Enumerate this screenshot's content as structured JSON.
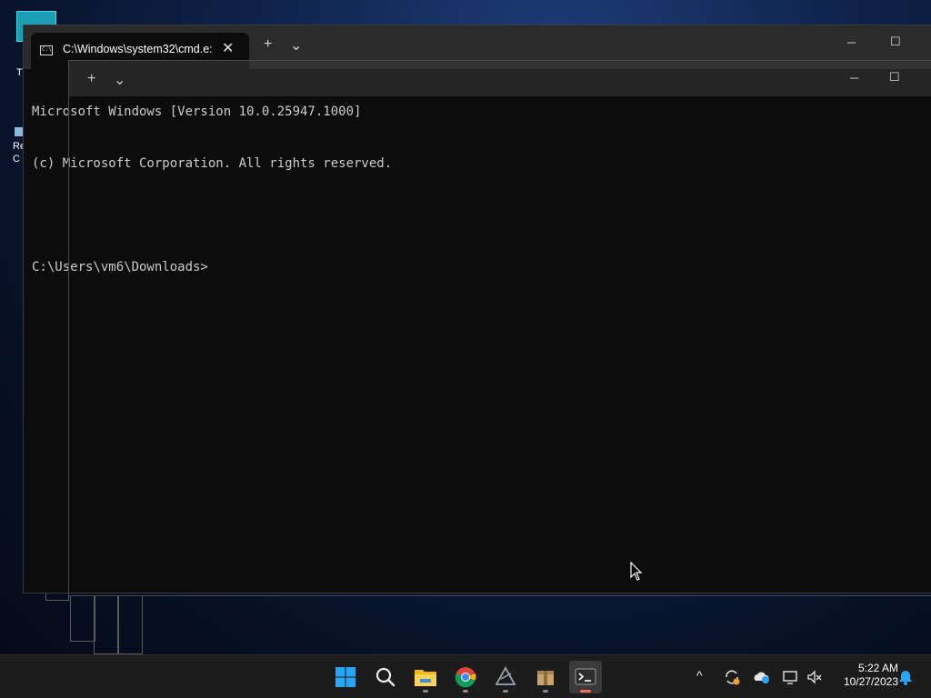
{
  "desktop": {
    "icons": [
      {
        "label": "T"
      },
      {
        "label": "Re C"
      }
    ]
  },
  "window": {
    "tab_title": "C:\\Windows\\system32\\cmd.e:",
    "tab_icon_text": "C:\\",
    "close_tab_glyph": "✕",
    "new_tab_glyph": "+",
    "dropdown_glyph": "⌄",
    "minimize_glyph": "─",
    "maximize_glyph": "☐",
    "console_lines": [
      "Microsoft Windows [Version 10.0.25947.1000]",
      "(c) Microsoft Corporation. All rights reserved.",
      "",
      "C:\\Users\\vm6\\Downloads>"
    ]
  },
  "ghost_window": {
    "new_tab_glyph": "+",
    "dropdown_glyph": "⌄",
    "minimize_glyph": "─",
    "maximize_glyph": "☐"
  },
  "taskbar": {
    "apps": [
      {
        "name": "start",
        "active": false
      },
      {
        "name": "search",
        "active": false
      },
      {
        "name": "file-explorer",
        "active": false
      },
      {
        "name": "chrome",
        "active": false
      },
      {
        "name": "app",
        "active": false
      },
      {
        "name": "package",
        "active": false
      },
      {
        "name": "terminal",
        "active": true
      }
    ],
    "tray": {
      "chevron_glyph": "^",
      "time": "5:22 AM",
      "date": "10/27/2023"
    }
  },
  "colors": {
    "accent_red": "#ff6b5e",
    "console_bg": "#0c0c0c",
    "console_text": "#cccccc"
  }
}
